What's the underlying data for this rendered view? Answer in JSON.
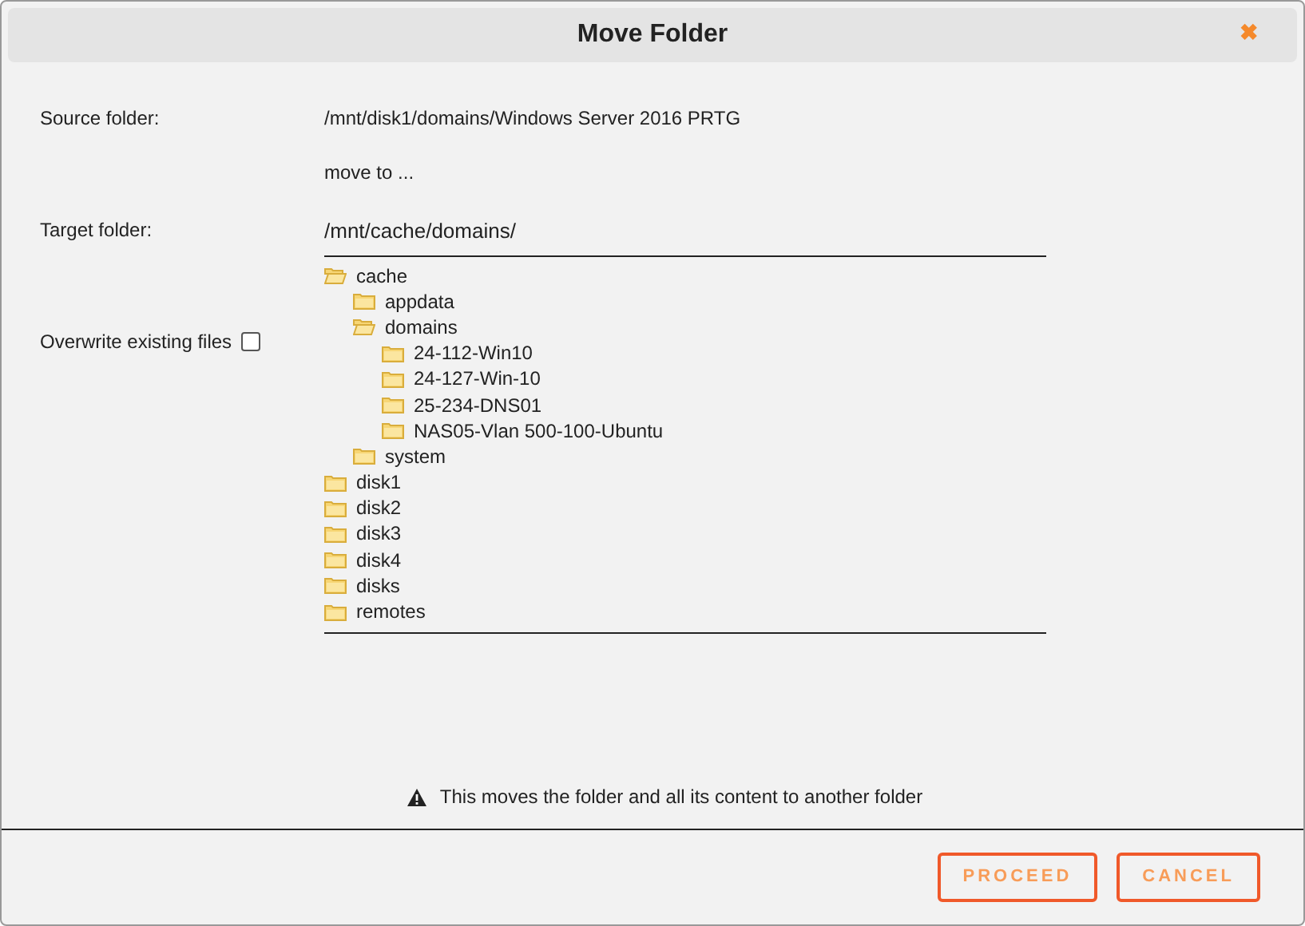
{
  "dialog": {
    "title": "Move Folder",
    "close": "✖"
  },
  "source": {
    "label": "Source folder:",
    "value": "/mnt/disk1/domains/Windows Server 2016 PRTG"
  },
  "move_to": "move to ...",
  "target": {
    "label": "Target folder:",
    "value": "/mnt/cache/domains/"
  },
  "overwrite": {
    "label": "Overwrite existing files",
    "checked": false
  },
  "tree": [
    {
      "name": "cache",
      "expanded": true,
      "children": [
        {
          "name": "appdata",
          "expanded": false
        },
        {
          "name": "domains",
          "expanded": true,
          "children": [
            {
              "name": "24-112-Win10",
              "expanded": false
            },
            {
              "name": "24-127-Win-10",
              "expanded": false
            },
            {
              "name": "25-234-DNS01",
              "expanded": false
            },
            {
              "name": "NAS05-Vlan 500-100-Ubuntu",
              "expanded": false
            }
          ]
        },
        {
          "name": "system",
          "expanded": false
        }
      ]
    },
    {
      "name": "disk1",
      "expanded": false
    },
    {
      "name": "disk2",
      "expanded": false
    },
    {
      "name": "disk3",
      "expanded": false
    },
    {
      "name": "disk4",
      "expanded": false
    },
    {
      "name": "disks",
      "expanded": false
    },
    {
      "name": "remotes",
      "expanded": false
    }
  ],
  "warning": "This moves the folder and all its content to another folder",
  "buttons": [
    "PROCEED",
    "CANCEL"
  ]
}
